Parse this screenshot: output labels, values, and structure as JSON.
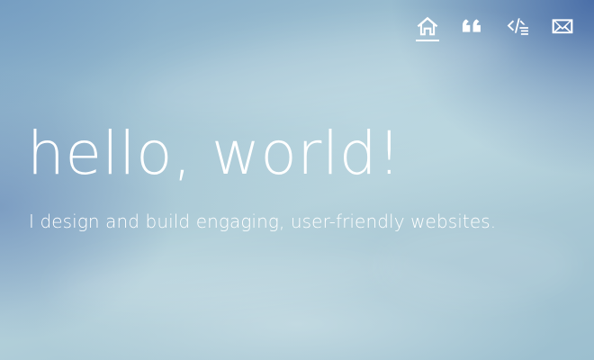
{
  "nav": {
    "items": [
      {
        "icon": "home-icon",
        "active": true
      },
      {
        "icon": "quote-icon",
        "active": false
      },
      {
        "icon": "code-icon",
        "active": false
      },
      {
        "icon": "mail-icon",
        "active": false
      }
    ]
  },
  "hero": {
    "title": "hello, world!",
    "subtitle": "I design and build engaging, user-friendly websites."
  },
  "colors": {
    "text": "#ffffff",
    "sky_dark": "#3a5fa0",
    "sky_light": "#b3d0da"
  }
}
